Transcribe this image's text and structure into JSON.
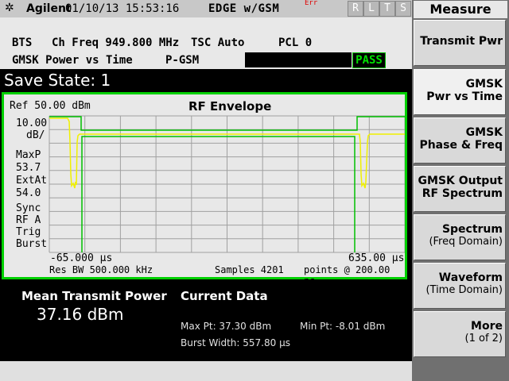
{
  "topbar": {
    "brand": "Agilent",
    "datetime": "01/10/13 15:53:16",
    "mode": "EDGE w/GSM",
    "err": "Err",
    "status_boxes": [
      "R",
      "L",
      "T",
      "S"
    ]
  },
  "info": {
    "standard": "BTS",
    "ch_freq": "Ch Freq 949.800 MHz",
    "tsc": "TSC Auto",
    "pcl": "PCL 0",
    "measurement": "GMSK Power vs Time",
    "band": "P-GSM",
    "result": "PASS"
  },
  "save_state": "Save State: 1",
  "graph": {
    "ref": "Ref 50.00 dBm",
    "title": "RF Envelope",
    "scale_value": "10.00",
    "scale_unit": "dB/",
    "maxp_label": "MaxP",
    "maxp_value": "53.7",
    "extat_label": "ExtAt",
    "extat_value": "54.0",
    "sync_label": "Sync",
    "sync_value": "RF A",
    "trig_label": "Trig",
    "trig_value": "Burst",
    "x_start": "-65.000 µs",
    "x_stop": "635.00 µs",
    "res_bw": "Res BW 500.000 kHz",
    "samples": "Samples 4201",
    "points": "points @ 200.00 ns"
  },
  "results": {
    "mean_title": "Mean Transmit Power",
    "mean_value": "37.16 dBm",
    "current_title": "Current Data",
    "max_pt": "Max Pt: 37.30 dBm",
    "min_pt": "Min Pt: -8.01 dBm",
    "burst_width": "Burst Width: 557.80 µs"
  },
  "softkeys": {
    "title": "Measure",
    "items": [
      {
        "l1": "Transmit Pwr",
        "l2": ""
      },
      {
        "l1": "GMSK",
        "l2": "Pwr vs Time"
      },
      {
        "l1": "GMSK",
        "l2": "Phase & Freq"
      },
      {
        "l1": "GMSK Output",
        "l2": "RF Spectrum"
      },
      {
        "l1": "Spectrum",
        "l2": "(Freq Domain)"
      },
      {
        "l1": "Waveform",
        "l2": "(Time Domain)"
      },
      {
        "l1": "More",
        "l2": "(1 of 2)"
      }
    ]
  },
  "colors": {
    "trace_yellow": "#f0f000",
    "mask_green": "#00c000",
    "pass_green": "#00e000",
    "err_red": "#e00000"
  }
}
